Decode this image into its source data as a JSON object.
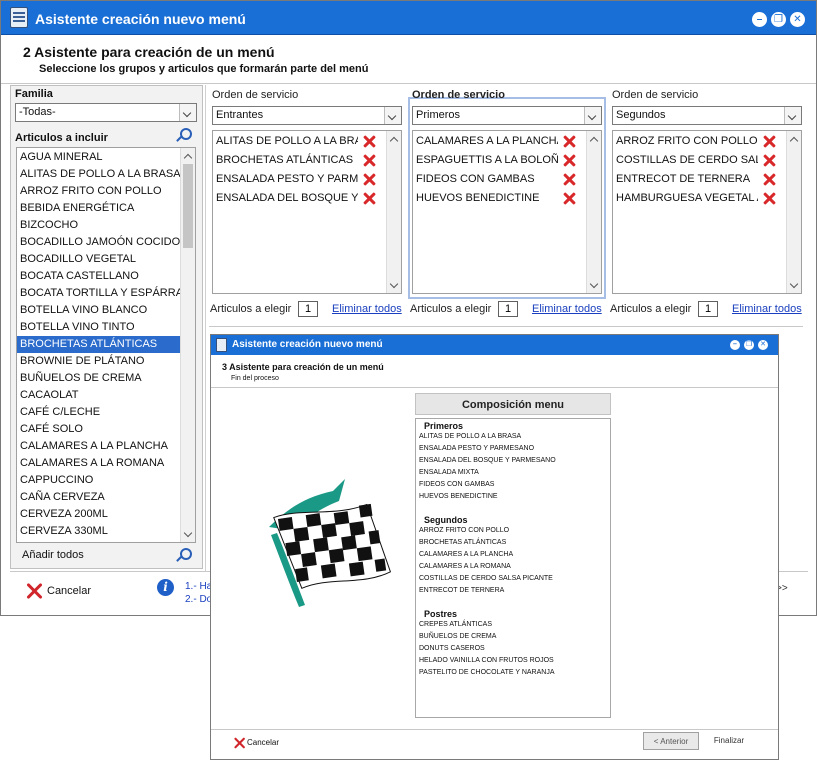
{
  "main": {
    "title": "Asistente creación nuevo menú",
    "step": "2  Asistente para creación de un menú",
    "subtitle": "Seleccione los grupos y articulos que formarán parte del menú",
    "window_buttons": {
      "minimize": "–",
      "restore": "❐",
      "close": "✕"
    },
    "left": {
      "familia_label": "Familia",
      "familia_value": "-Todas-",
      "articles_label": "Articulos a incluir",
      "add_all_label": "Añadir todos",
      "articles": [
        "AGUA MINERAL",
        "ALITAS DE POLLO A LA BRASA",
        "ARROZ FRITO CON POLLO",
        "BEBIDA ENERGÉTICA",
        "BIZCOCHO",
        "BOCADILLO JAMOÓN COCIDO",
        "BOCADILLO VEGETAL",
        "BOCATA CASTELLANO",
        "BOCATA TORTILLA Y ESPÁRRAG",
        "BOTELLA VINO BLANCO",
        "BOTELLA VINO TINTO",
        "BROCHETAS ATLÁNTICAS",
        "BROWNIE DE PLÁTANO",
        "BUÑUELOS DE CREMA",
        "CACAOLAT",
        "CAFÉ C/LECHE",
        "CAFÉ SOLO",
        "CALAMARES A LA PLANCHA",
        "CALAMARES A LA ROMANA",
        "CAPPUCCINO",
        "CAÑA CERVEZA",
        "CERVEZA 200ML",
        "CERVEZA 330ML"
      ],
      "selected_index": 11
    },
    "columns": [
      {
        "label": "Orden de servicio",
        "value": "Entrantes",
        "items": [
          "ALITAS DE POLLO A LA BRA",
          "BROCHETAS ATLÁNTICAS",
          "ENSALADA PESTO Y PARME",
          "ENSALADA DEL BOSQUE Y I"
        ],
        "elegir_label": "Articulos a elegir",
        "elegir_value": "1",
        "remove_all_label": "Eliminar todos"
      },
      {
        "label": "Orden de servicio",
        "value": "Primeros",
        "items": [
          "CALAMARES A LA PLANCHA",
          "ESPAGUETTIS A LA BOLOÑE",
          "FIDEOS CON GAMBAS",
          "HUEVOS BENEDICTINE"
        ],
        "elegir_label": "Articulos a elegir",
        "elegir_value": "1",
        "remove_all_label": "Eliminar todos"
      },
      {
        "label": "Orden de servicio",
        "value": "Segundos",
        "items": [
          "ARROZ FRITO CON POLLO",
          "COSTILLAS DE CERDO SALS",
          "ENTRECOT DE TERNERA",
          "HAMBURGUESA VEGETAL A"
        ],
        "elegir_label": "Articulos a elegir",
        "elegir_value": "1",
        "remove_all_label": "Eliminar todos"
      }
    ],
    "footer": {
      "cancel_label": "Cancelar",
      "step_links": [
        "1.- Ha",
        "2.- Do"
      ],
      "next_arrow": ">>"
    }
  },
  "overlay": {
    "title": "Asistente creación nuevo menú",
    "window_buttons": {
      "minimize": "–",
      "restore": "❐",
      "close": "✕"
    },
    "step": "3  Asistente para creación de un menú",
    "subtitle": "Fin del proceso",
    "composition_title": "Composición menu",
    "sections": [
      {
        "name": "Primeros",
        "items": [
          "ALITAS DE POLLO A LA BRASA",
          "ENSALADA PESTO Y PARMESANO",
          "ENSALADA DEL BOSQUE Y PARMESANO",
          "ENSALADA MIXTA",
          "FIDEOS CON GAMBAS",
          "HUEVOS BENEDICTINE"
        ]
      },
      {
        "name": "Segundos",
        "items": [
          "ARROZ FRITO CON POLLO",
          "BROCHETAS ATLÁNTICAS",
          "CALAMARES A LA PLANCHA",
          "CALAMARES A LA ROMANA",
          "COSTILLAS DE CERDO SALSA PICANTE",
          "ENTRECOT DE TERNERA"
        ]
      },
      {
        "name": "Postres",
        "items": [
          "CREPES ATLÁNTICAS",
          "BUÑUELOS DE CREMA",
          "DONUTS CASEROS",
          "HELADO VAINILLA CON FRUTOS ROJOS",
          "PASTELITO DE CHOCOLATE Y NARANJA"
        ]
      }
    ],
    "footer": {
      "cancel_label": "Cancelar",
      "back_label": "< Anterior",
      "finish_label": "Finalizar"
    }
  },
  "colors": {
    "titlebar": "#1a6fd6",
    "selection": "#2a6bcc",
    "remove": "#d8282a",
    "link": "#1a3fbf"
  }
}
